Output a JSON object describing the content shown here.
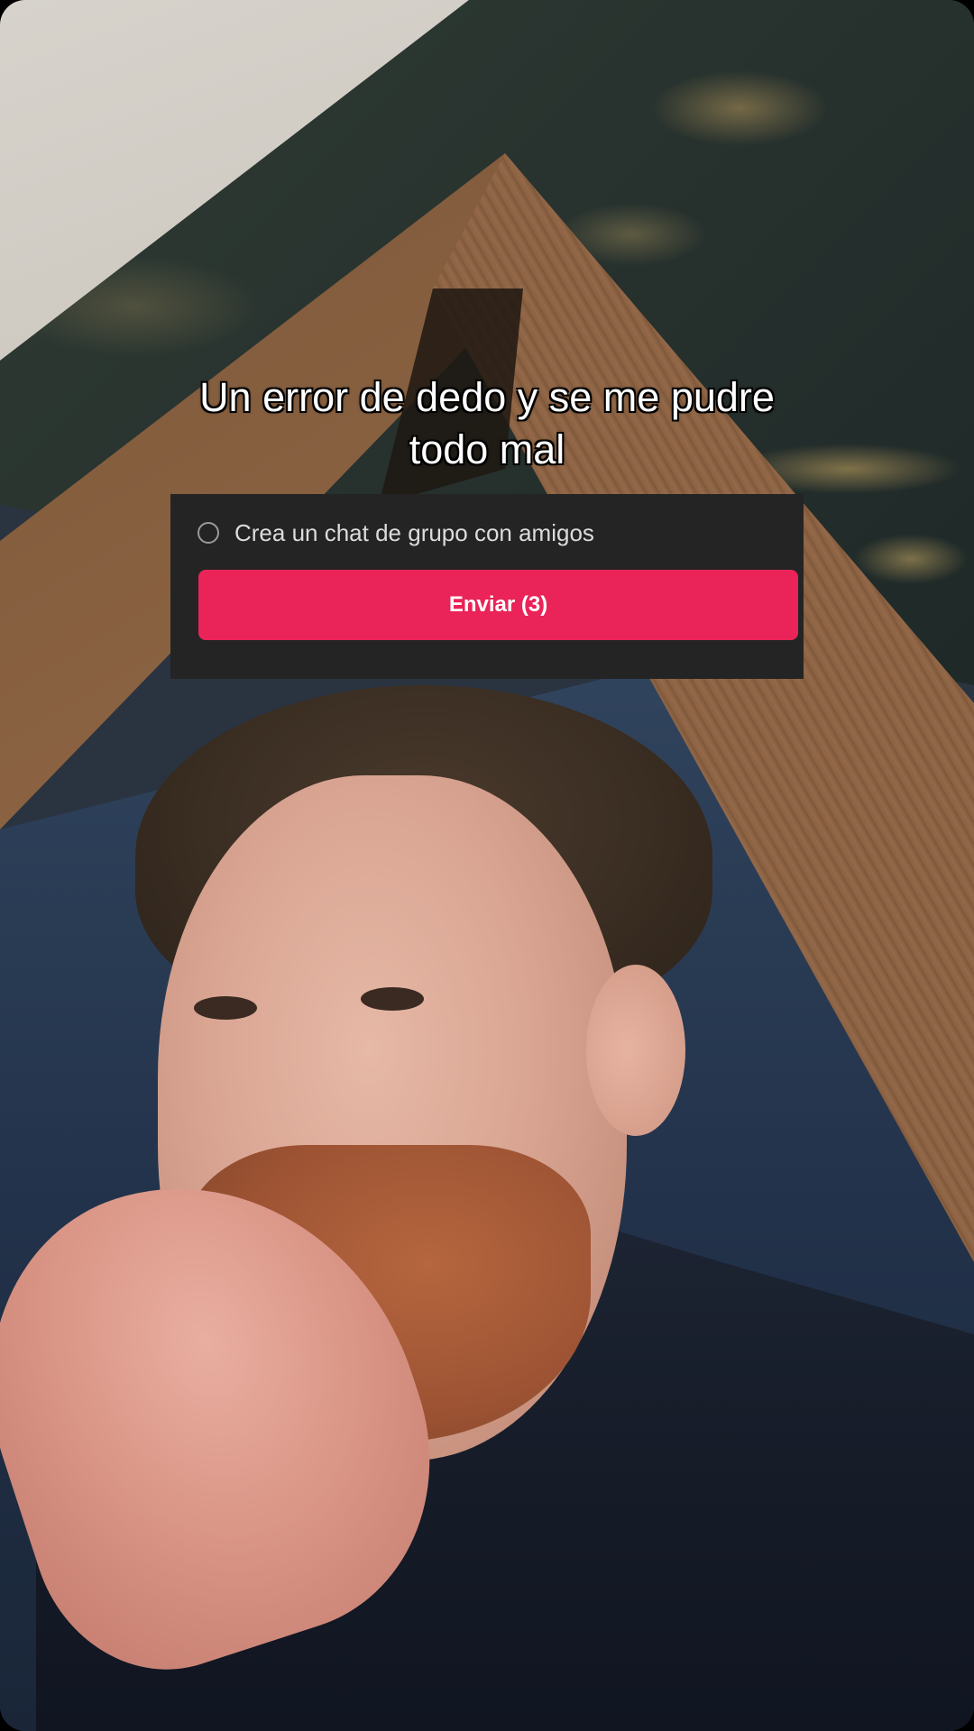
{
  "caption": {
    "line1": "Un error de dedo y se me pudre",
    "line2": "todo mal"
  },
  "share_panel": {
    "option_label": "Crea un chat de grupo con amigos",
    "send_label": "Enviar (3)"
  },
  "colors": {
    "send_button": "#ea2458",
    "panel_background": "#242424"
  }
}
